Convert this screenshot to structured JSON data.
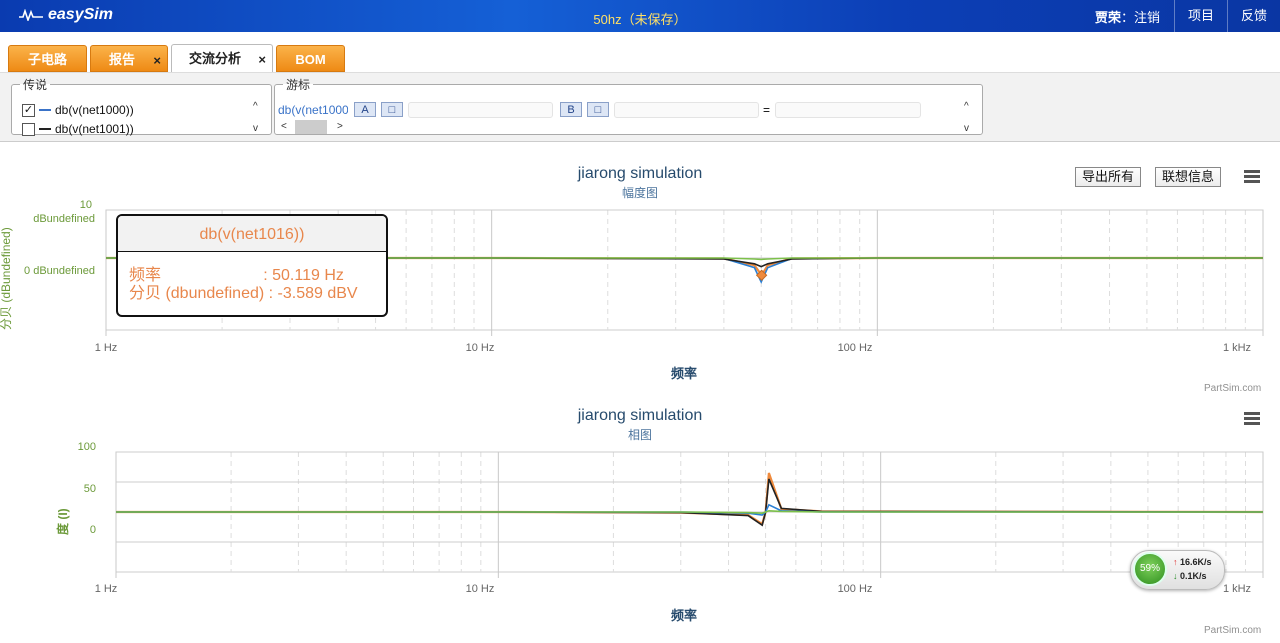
{
  "app": {
    "logo_text": "easySim",
    "document_title": "50hz（未保存）"
  },
  "topbar": {
    "user_name": "贾荣",
    "logout_label": "：注销",
    "project_label": "项目",
    "feedback_label": "反馈"
  },
  "tabs": [
    {
      "label": "子电路"
    },
    {
      "label": "报告",
      "close": "×"
    },
    {
      "label": "交流分析",
      "close": "×"
    },
    {
      "label": "BOM"
    }
  ],
  "legend_panel": {
    "title": "传说",
    "items": [
      {
        "label": "db(v(net1000))",
        "checked": true,
        "check_mark": "✓",
        "color": "#3a73c8"
      },
      {
        "label": "db(v(net1001))",
        "checked": false,
        "check_mark": "",
        "color": "#222222"
      }
    ],
    "scroll_up": "^",
    "scroll_down": "v"
  },
  "cursor_panel": {
    "title": "游标",
    "trace": "db(v(net1000",
    "cursor_a": "A",
    "cursor_b": "B",
    "small_btn": "□",
    "equals": "=",
    "scroll_left": "<",
    "scroll_right": ">",
    "scroll_up": "^",
    "scroll_down": "v"
  },
  "buttons": {
    "export_all": "导出所有",
    "contact_info": "联想信息"
  },
  "magnitude_chart": {
    "title": "jiarong simulation",
    "subtitle": "幅度图",
    "ylabel": "分贝 (dBundefined)",
    "xlabel": "频率",
    "credit": "PartSim.com",
    "y_ticks": [
      {
        "label": "10",
        "value": 10
      },
      {
        "label": "dBundefined",
        "value": 10
      },
      {
        "label": "0 dBundefined",
        "value": 0
      }
    ],
    "x_ticks": [
      "1 Hz",
      "10 Hz",
      "100 Hz",
      "1 kHz"
    ],
    "tooltip": {
      "series": "db(v(net1016))",
      "freq_line": "频率                       : 50.119 Hz",
      "db_line": "分贝 (dbundefined) : -3.589 dBV"
    }
  },
  "phase_chart": {
    "title": "jiarong simulation",
    "subtitle": "相图",
    "ylabel": "度 (I)",
    "xlabel": "频率",
    "credit": "PartSim.com",
    "y_ticks": [
      "100",
      "50",
      "0"
    ],
    "x_ticks": [
      "1 Hz",
      "10 Hz",
      "100 Hz",
      "1 kHz"
    ]
  },
  "network_widget": {
    "percent": "59%",
    "up_arrow": "↑",
    "down_arrow": "↓",
    "up_rate": "16.6K/s",
    "down_rate": "0.1K/s"
  },
  "chart_data": [
    {
      "type": "line",
      "title": "jiarong simulation",
      "subtitle": "幅度图",
      "xlabel": "频率",
      "ylabel": "分贝 (dBundefined)",
      "x_scale": "log",
      "xlim": [
        1,
        1000
      ],
      "ylim": [
        -15,
        10
      ],
      "grid": true,
      "series": [
        {
          "name": "db(v(net1016))",
          "color": "#ef8a3c",
          "x": [
            1,
            10,
            40,
            48,
            50.119,
            52,
            60,
            100,
            1000
          ],
          "y": [
            0,
            0,
            -0.1,
            -1.5,
            -3.589,
            -1.5,
            -0.1,
            0,
            0
          ]
        },
        {
          "color": "#2a7fd4",
          "x": [
            1,
            10,
            40,
            48,
            50,
            52,
            60,
            100,
            1000
          ],
          "y": [
            0,
            0,
            -0.1,
            -2,
            -5,
            -2,
            -0.1,
            0,
            0
          ]
        },
        {
          "color": "#222222",
          "x": [
            1,
            10,
            40,
            48,
            50,
            52,
            60,
            100,
            1000
          ],
          "y": [
            0,
            0,
            -0.2,
            -1.2,
            -1.8,
            -1.2,
            -0.2,
            0,
            0
          ]
        },
        {
          "color": "#7cc04a",
          "x": [
            1,
            10,
            40,
            48,
            50,
            52,
            60,
            100,
            1000
          ],
          "y": [
            0,
            0,
            0,
            -0.2,
            -0.3,
            -0.2,
            0,
            0,
            0
          ]
        }
      ]
    },
    {
      "type": "line",
      "title": "jiarong simulation",
      "subtitle": "相图",
      "xlabel": "频率",
      "ylabel": "度 (I)",
      "x_scale": "log",
      "xlim": [
        1,
        1000
      ],
      "ylim": [
        -100,
        100
      ],
      "grid": true,
      "series": [
        {
          "color": "#ef8a3c",
          "x": [
            1,
            10,
            30,
            45,
            49,
            50,
            51,
            55,
            70,
            1000
          ],
          "y": [
            0,
            0,
            -1,
            -5,
            -20,
            0,
            65,
            5,
            1,
            0
          ]
        },
        {
          "color": "#222222",
          "x": [
            1,
            10,
            30,
            45,
            49,
            50,
            51,
            55,
            70,
            1000
          ],
          "y": [
            0,
            0,
            -1,
            -6,
            -22,
            0,
            55,
            6,
            1,
            0
          ]
        },
        {
          "color": "#2a7fd4",
          "x": [
            1,
            10,
            30,
            45,
            49,
            50,
            51,
            55,
            70,
            1000
          ],
          "y": [
            0,
            0,
            0,
            -2,
            -5,
            0,
            12,
            2,
            0,
            0
          ]
        },
        {
          "color": "#7cc04a",
          "x": [
            1,
            10,
            30,
            45,
            49,
            50,
            51,
            55,
            70,
            1000
          ],
          "y": [
            0,
            0,
            0,
            -1,
            -2,
            0,
            2,
            1,
            0,
            0
          ]
        }
      ]
    }
  ]
}
